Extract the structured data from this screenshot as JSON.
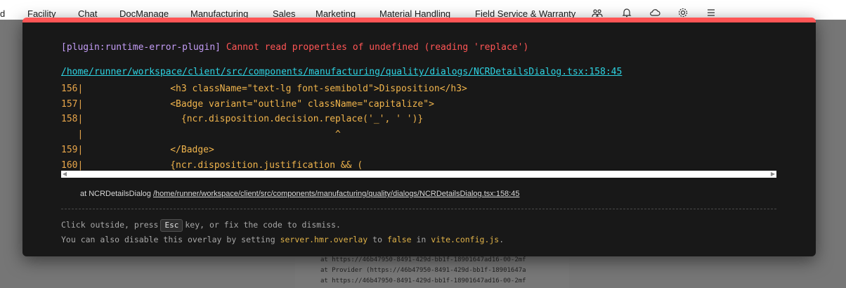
{
  "background_app": {
    "nav_items": [
      "d",
      "Facility",
      "Chat",
      "DocManage",
      "Manufacturing",
      "Sales",
      "Marketing",
      "Material Handling",
      "Field Service & Warranty"
    ],
    "nav_icons": [
      "users-icon",
      "bell-icon",
      "cloud-icon",
      "gear-icon",
      "menu-icon"
    ],
    "trace_lines": [
      "at https://46b47950-8491-429d-bb1f-18901647ad16-00-2mf",
      "at Provider (https://46b47950-8491-429d-bb1f-18901647a",
      "at https://46b47950-8491-429d-bb1f-18901647ad16-00-2mf"
    ]
  },
  "overlay": {
    "accent_color": "#ff5555",
    "plugin": "[plugin:runtime-error-plugin]",
    "message": "Cannot read properties of undefined (reading 'replace')",
    "file": "/home/runner/workspace/client/src/components/manufacturing/quality/dialogs/NCRDetailsDialog.tsx:158:45",
    "frame_lines": [
      {
        "num": "156|",
        "code": "                <h3 className=\"text-lg font-semibold\">Disposition</h3>"
      },
      {
        "num": "157|",
        "code": "                <Badge variant=\"outline\" className=\"capitalize\">"
      },
      {
        "num": "158|",
        "code": "                  {ncr.disposition.decision.replace('_', ' ')}"
      },
      {
        "num": "   |",
        "code": "                                              ^"
      },
      {
        "num": "159|",
        "code": "                </Badge>"
      },
      {
        "num": "160|",
        "code": "                {ncr.disposition.justification && ("
      }
    ],
    "stack": {
      "prefix": "at NCRDetailsDialog",
      "path": "/home/runner/workspace/client/src/components/manufacturing/quality/dialogs/NCRDetailsDialog.tsx:158:45"
    },
    "tip1": {
      "before": "Click outside, press",
      "key": "Esc",
      "after": "key, or fix the code to dismiss."
    },
    "tip2": {
      "before": "You can also disable this overlay by setting",
      "setting": "server.hmr.overlay",
      "to": "to",
      "value": "false",
      "in": "in",
      "file": "vite.config.js",
      "end": "."
    }
  }
}
